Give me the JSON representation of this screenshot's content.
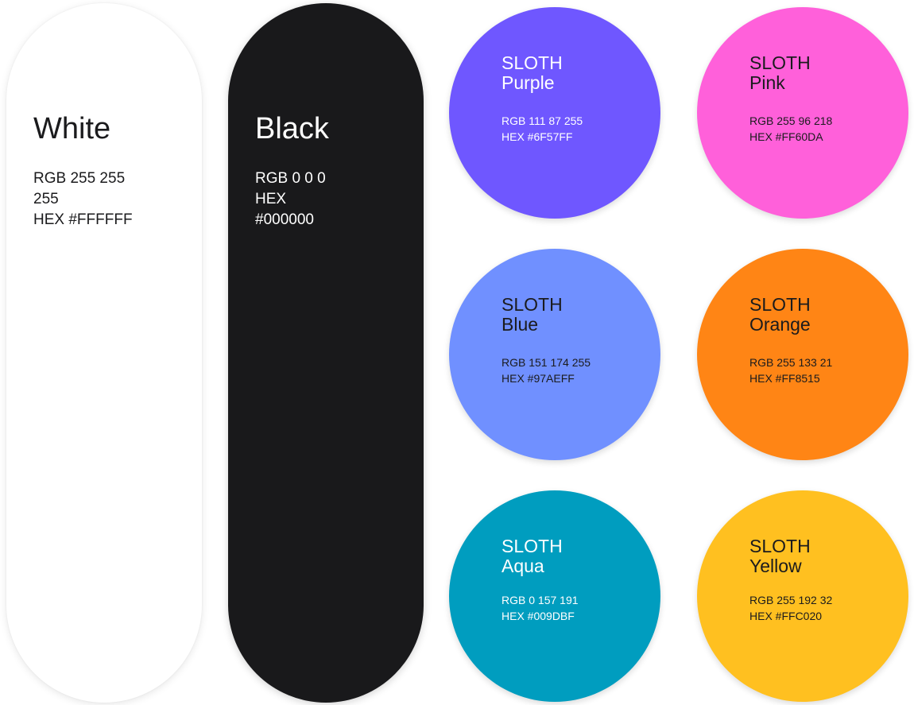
{
  "pills": {
    "white": {
      "title": "White",
      "rgb": "RGB 255 255 255",
      "hex": "HEX #FFFFFF",
      "color": "#FFFFFF"
    },
    "black": {
      "title": "Black",
      "rgb": "RGB 0 0 0",
      "hex": "HEX #000000",
      "color": "#19191B"
    }
  },
  "circles": {
    "purple": {
      "brand": "SLOTH",
      "name": "Purple",
      "rgb": "RGB 111 87 255",
      "hex": "HEX #6F57FF",
      "color": "#6F57FF"
    },
    "pink": {
      "brand": "SLOTH",
      "name": "Pink",
      "rgb": "RGB 255 96 218",
      "hex": "HEX #FF60DA",
      "color": "#FF60DA"
    },
    "blue": {
      "brand": "SLOTH",
      "name": "Blue",
      "rgb": "RGB 151 174 255",
      "hex": "HEX #97AEFF",
      "color": "#7090FF"
    },
    "orange": {
      "brand": "SLOTH",
      "name": "Orange",
      "rgb": "RGB 255 133 21",
      "hex": "HEX #FF8515",
      "color": "#FF8515"
    },
    "aqua": {
      "brand": "SLOTH",
      "name": "Aqua",
      "rgb": "RGB 0 157 191",
      "hex": "HEX #009DBF",
      "color": "#009DBF"
    },
    "yellow": {
      "brand": "SLOTH",
      "name": "Yellow",
      "rgb": "RGB 255 192 32",
      "hex": "HEX #FFC020",
      "color": "#FFC020"
    }
  }
}
